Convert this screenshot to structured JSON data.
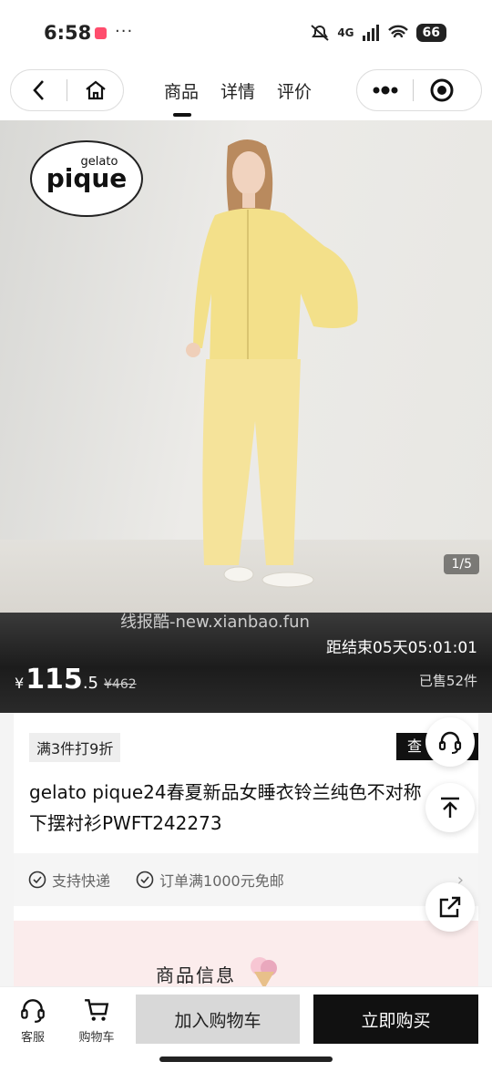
{
  "status": {
    "time": "6:58",
    "network": "4G",
    "battery": "66"
  },
  "nav": {
    "tabs": [
      {
        "label": "商品",
        "active": true
      },
      {
        "label": "详情"
      },
      {
        "label": "评价"
      }
    ]
  },
  "hero": {
    "brand_line1": "gelato",
    "brand_line2": "pique",
    "counter": "1/5"
  },
  "price_band": {
    "watermark": "线报酷-new.xianbao.fun",
    "countdown": "距结束05天05:01:01",
    "currency": "¥",
    "price_int": "115",
    "price_dec": ".5",
    "original_price": "¥462",
    "sold": "已售52件"
  },
  "product": {
    "promo": "满3件打9折",
    "check_tag": "查",
    "title": "gelato pique24春夏新品女睡衣铃兰纯色不对称下摆衬衫PWFT242273",
    "services": [
      "支持快递",
      "订单满1000元免邮"
    ],
    "info_title": "商品信息"
  },
  "bottom": {
    "service_label": "客服",
    "cart_label": "购物车",
    "add_to_cart": "加入购物车",
    "buy_now": "立即购买"
  },
  "colors": {
    "accent": "#111111",
    "info_bg": "#fbecec"
  }
}
